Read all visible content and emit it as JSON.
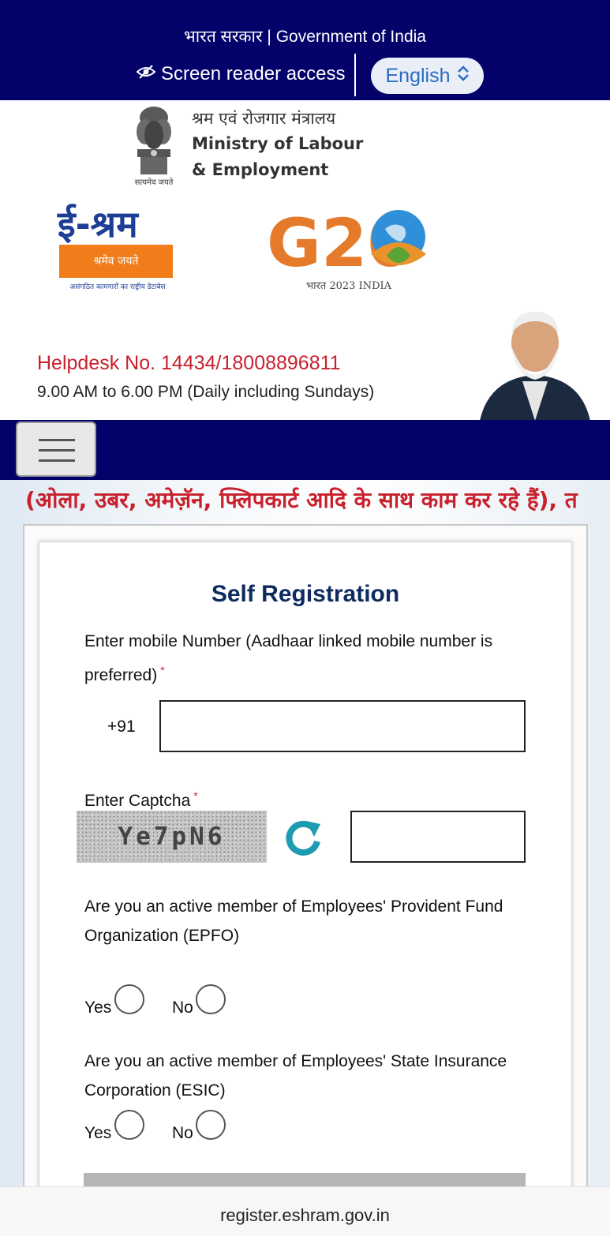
{
  "gov_bar": {
    "title": "भारत सरकार | Government of India",
    "screen_reader_label": "Screen reader access",
    "language_selected": "English"
  },
  "ministry": {
    "hindi_name": "श्रम एवं रोजगार मंत्रालय",
    "name_line1": "Ministry of Labour",
    "name_line2": "& Employment",
    "emblem_motto": "सत्यमेव जयते"
  },
  "eshram_logo": {
    "title": "ई-श्रम",
    "motto": "श्रमेव जयते",
    "subtitle": "असंगठित कामगारों का राष्ट्रीय डेटाबेस"
  },
  "g20_logo": {
    "mark": "G20",
    "caption": "भारत 2023 INDIA"
  },
  "helpdesk": {
    "number": "Helpdesk No. 14434/18008896811",
    "hours": "9.00 AM to 6.00 PM (Daily including Sundays)"
  },
  "ticker_text": "(ओला, उबर, अमेज़ॅन, फ्लिपकार्ट आदि के साथ काम कर रहे हैं), त",
  "form": {
    "title": "Self Registration",
    "mobile_label": "Enter mobile Number (Aadhaar linked mobile number is preferred)",
    "country_code": "+91",
    "mobile_value": "",
    "captcha_label": "Enter Captcha",
    "captcha_text": "Ye7pN6",
    "captcha_value": "",
    "epfo_question": "Are you an active member of Employees' Provident Fund Organization (EPFO)",
    "esic_question": "Are you an active member of Employees' State Insurance Corporation (ESIC)",
    "yes_label": "Yes",
    "no_label": "No",
    "required_mark": "*"
  },
  "browser": {
    "url": "register.eshram.gov.in"
  },
  "colors": {
    "navy": "#02026a",
    "helpdesk_red": "#c8202c",
    "title_navy": "#0e2a5f",
    "refresh_teal": "#1d9bb0"
  }
}
